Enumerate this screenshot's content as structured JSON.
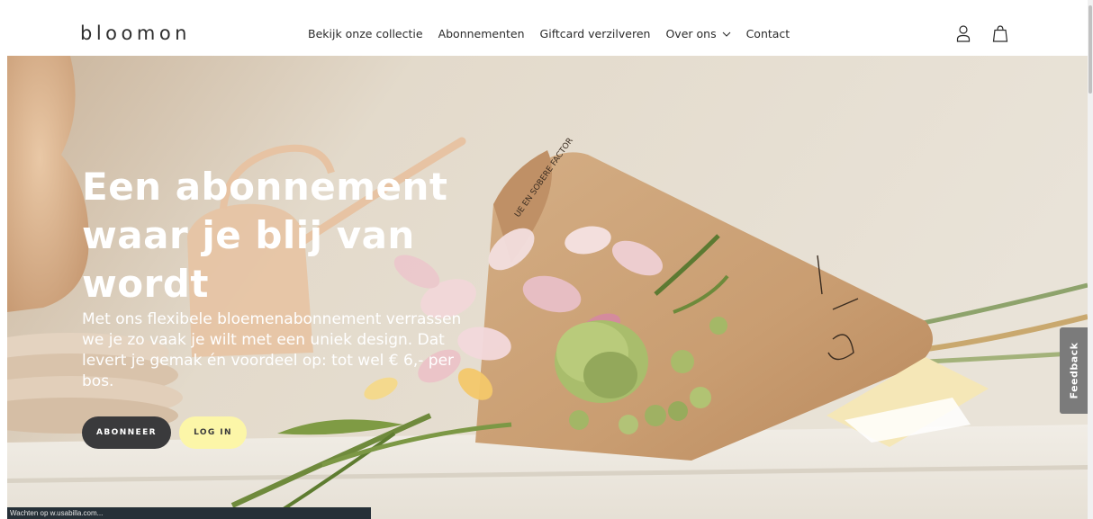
{
  "brand": {
    "logo_text": "bloomon"
  },
  "nav": {
    "items": [
      {
        "label": "Bekijk onze collectie",
        "name": "nav-collection-link"
      },
      {
        "label": "Abonnementen",
        "name": "nav-subscriptions-link"
      },
      {
        "label": "Giftcard verzilveren",
        "name": "nav-giftcard-link"
      },
      {
        "label": "Over ons",
        "name": "nav-about-link",
        "has_dropdown": true
      },
      {
        "label": "Contact",
        "name": "nav-contact-link"
      }
    ]
  },
  "header_icons": {
    "account": "user-icon",
    "cart": "shopping-bag-icon"
  },
  "hero": {
    "title": "Een abonnement waar je blij van wordt",
    "text": "Met ons flexibele bloemenabonnement verrassen we je zo vaak je wilt met een uniek design. Dat levert je gemak én voordeel op: tot wel € 6,- per bos.",
    "primary_button": "ABONNEER",
    "secondary_button": "LOG IN",
    "image": "bouquet-in-paper-cone"
  },
  "feedback_tab": {
    "label": "Feedback"
  },
  "status_bar": {
    "text": "Wachten op w.usabilla.com..."
  },
  "colors": {
    "button_dark": "#3a3a3c",
    "button_light": "#fcf6a8",
    "feedback_tab": "#7b7b7b",
    "wall": "#ddd5c6"
  }
}
